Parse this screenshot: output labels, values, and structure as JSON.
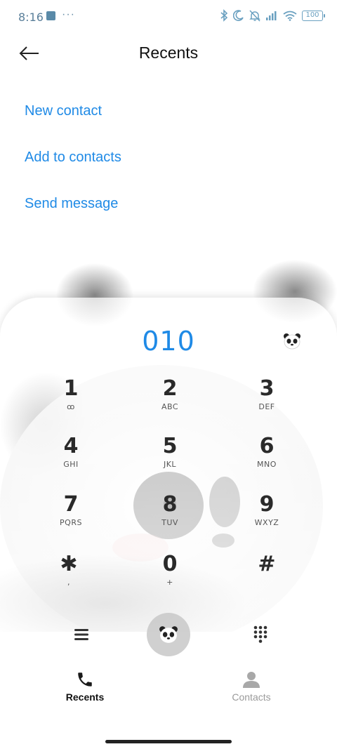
{
  "status_bar": {
    "time": "8:16",
    "overflow_dots": "···",
    "battery_level": "100"
  },
  "header": {
    "title": "Recents"
  },
  "actions": {
    "new_contact": "New contact",
    "add_to_contacts": "Add to contacts",
    "send_message": "Send message"
  },
  "dialer": {
    "number": "010",
    "keys": [
      {
        "digit": "1",
        "letters": "ꝏ"
      },
      {
        "digit": "2",
        "letters": "ABC"
      },
      {
        "digit": "3",
        "letters": "DEF"
      },
      {
        "digit": "4",
        "letters": "GHI"
      },
      {
        "digit": "5",
        "letters": "JKL"
      },
      {
        "digit": "6",
        "letters": "MNO"
      },
      {
        "digit": "7",
        "letters": "PQRS"
      },
      {
        "digit": "8",
        "letters": "TUV"
      },
      {
        "digit": "9",
        "letters": "WXYZ"
      },
      {
        "digit": "✱",
        "letters": ","
      },
      {
        "digit": "0",
        "letters": "+"
      },
      {
        "digit": "#",
        "letters": ""
      }
    ]
  },
  "tabs": {
    "recents": "Recents",
    "contacts": "Contacts"
  },
  "colors": {
    "accent": "#1f8ae6",
    "active_tab": "#111111",
    "inactive_tab": "#9a9a9a"
  }
}
